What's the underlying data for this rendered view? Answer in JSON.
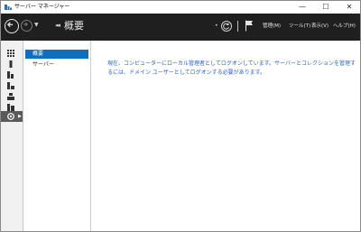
{
  "window": {
    "title": "サーバー マネージャー",
    "controls": {
      "minimize": "—",
      "maximize": "☐",
      "close": "✕"
    }
  },
  "header": {
    "breadcrumb_arrows": "◂◂",
    "page_title": "概要",
    "menu": [
      "管理(M)",
      "ツール(T)",
      "表示(V)",
      "ヘルプ(H)"
    ]
  },
  "rail": {
    "items": [
      {
        "icon": "dashboard-icon",
        "has_arrow": false
      },
      {
        "icon": "local-server-icon",
        "has_arrow": false
      },
      {
        "icon": "all-servers-icon",
        "has_arrow": false
      },
      {
        "icon": "file-storage-icon",
        "has_arrow": false
      },
      {
        "icon": "ad-ds-icon",
        "has_arrow": false
      },
      {
        "icon": "iis-icon",
        "has_arrow": true
      },
      {
        "icon": "remote-desktop-icon",
        "has_arrow": true,
        "selected": true
      }
    ]
  },
  "nav": {
    "items": [
      {
        "label": "概要",
        "selected": true
      },
      {
        "label": "サーバー",
        "selected": false
      }
    ]
  },
  "content": {
    "message": "現在、コンピューターにローカル管理者としてログオンしています。サーバーとコレクションを管理するには、ドメイン ユーザーとしてログオンする必要があります。"
  },
  "colors": {
    "header_bg": "#1f1f1f",
    "selection": "#0e6fbf",
    "message_text": "#2a5fd6"
  }
}
